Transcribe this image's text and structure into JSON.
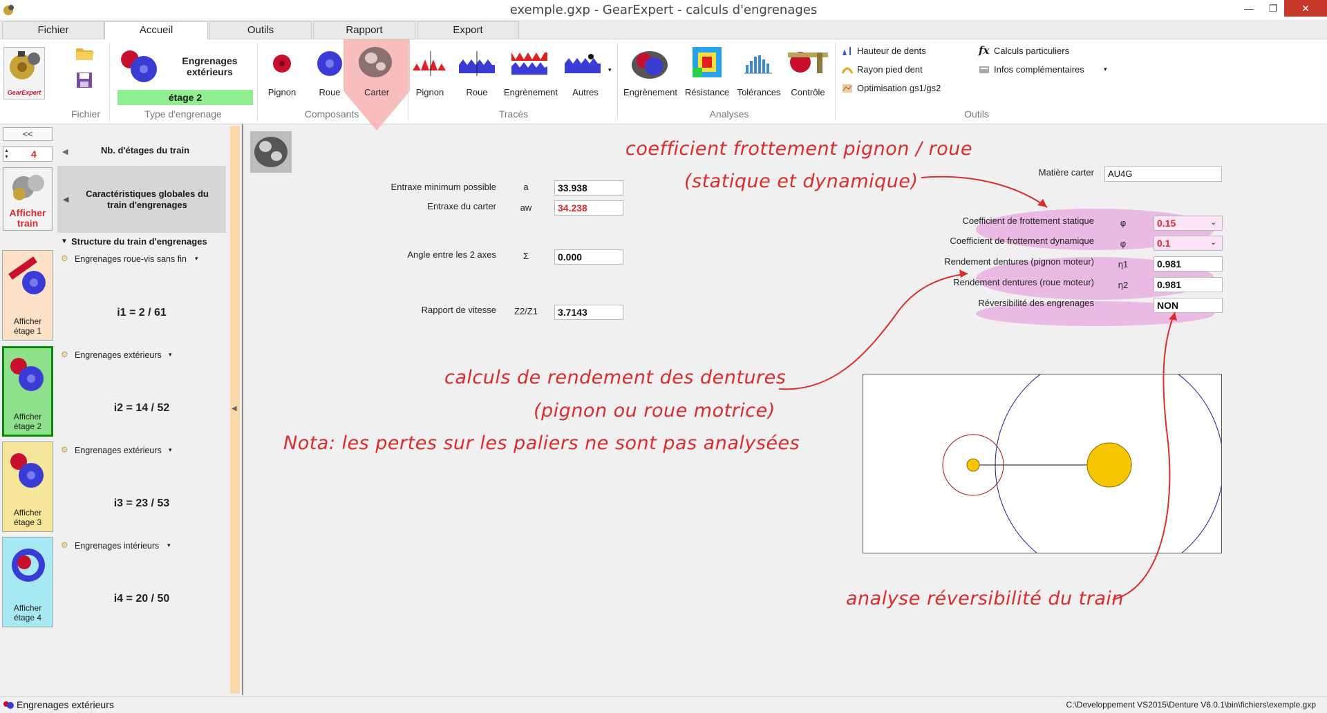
{
  "window": {
    "title": "exemple.gxp - GearExpert - calculs d'engrenages",
    "minimize": "—",
    "maximize": "❐",
    "close": "✕"
  },
  "tabs": [
    "Fichier",
    "Accueil",
    "Outils",
    "Rapport",
    "Export"
  ],
  "ribbon": {
    "type_title": "Engrenages\nextérieurs",
    "stage_badge": "étage 2",
    "components": [
      "Pignon",
      "Roue",
      "Carter"
    ],
    "traces": [
      "Pignon",
      "Roue",
      "Engrènement",
      "Autres"
    ],
    "analyses": [
      "Engrènement",
      "Résistance",
      "Tolérances",
      "Contrôle"
    ],
    "tools_left": [
      "Hauteur de dents",
      "Rayon pied dent",
      "Optimisation gs1/gs2"
    ],
    "tools_right": [
      "Calculs particuliers",
      "Infos complémentaires"
    ],
    "groups": [
      "Fichier",
      "Type d'engrenage",
      "Composants",
      "Tracés",
      "Analyses",
      "Outils"
    ],
    "logo_text": "GearExpert"
  },
  "left": {
    "collapse_btn": "<<",
    "stages_count": "4",
    "stages_label": "Nb. d'étages du train",
    "show_train": "Afficher\ntrain",
    "global_title": "Caractéristiques globales du\ntrain d'engrenages",
    "structure_title": "Structure du train d'engrenages",
    "stages": [
      {
        "type": "Engrenages roue-vis sans fin",
        "ratio": "i1 = 2 / 61",
        "label": "Afficher\nétage 1",
        "color": "#fde2c7"
      },
      {
        "type": "Engrenages extérieurs",
        "ratio": "i2 = 14 / 52",
        "label": "Afficher\nétage 2",
        "color": "#8ee08a"
      },
      {
        "type": "Engrenages extérieurs",
        "ratio": "i3 = 23 / 53",
        "label": "Afficher\nétage 3",
        "color": "#f5e69a"
      },
      {
        "type": "Engrenages intérieurs",
        "ratio": "i4 = 20 / 50",
        "label": "Afficher\nétage 4",
        "color": "#a7e9f2"
      }
    ]
  },
  "form": {
    "entraxe_min": {
      "label": "Entraxe minimum possible",
      "sym": "a",
      "value": "33.938"
    },
    "entraxe_carter": {
      "label": "Entraxe du carter",
      "sym": "aw",
      "value": "34.238"
    },
    "angle": {
      "label": "Angle entre les 2 axes",
      "sym": "Σ",
      "value": "0.000"
    },
    "rapport": {
      "label": "Rapport de vitesse",
      "sym": "Z2/Z1",
      "value": "3.7143"
    },
    "matiere": {
      "label": "Matière carter",
      "value": "AU4G"
    },
    "coef_stat": {
      "label": "Coefficient de frottement statique",
      "sym": "φ",
      "value": "0.15"
    },
    "coef_dyn": {
      "label": "Coefficient de frottement dynamique",
      "sym": "φ",
      "value": "0.1"
    },
    "rend1": {
      "label": "Rendement dentures (pignon moteur)",
      "sym": "η1",
      "value": "0.981"
    },
    "rend2": {
      "label": "Rendement dentures (roue moteur)",
      "sym": "η2",
      "value": "0.981"
    },
    "revers": {
      "label": "Réversibilité des engrenages",
      "value": "NON"
    }
  },
  "annotations": {
    "a1": "coefficient frottement pignon / roue",
    "a2": "(statique et dynamique)",
    "a3": "calculs de rendement des dentures",
    "a4": "(pignon ou roue motrice)",
    "a5": "Nota: les pertes sur les paliers ne sont pas analysées",
    "a6": "analyse réversibilité du train"
  },
  "status": {
    "left": "Engrenages extérieurs",
    "right": "C:\\Developpement VS2015\\Denture V6.0.1\\bin\\fichiers\\exemple.gxp"
  },
  "colors": {
    "accent_red": "#dd2a2a",
    "pink": "#e896dc",
    "badge_green": "#90ee90",
    "gear_blue": "#3b3bd6",
    "gear_red": "#c8102e",
    "gold": "#f7c600"
  }
}
